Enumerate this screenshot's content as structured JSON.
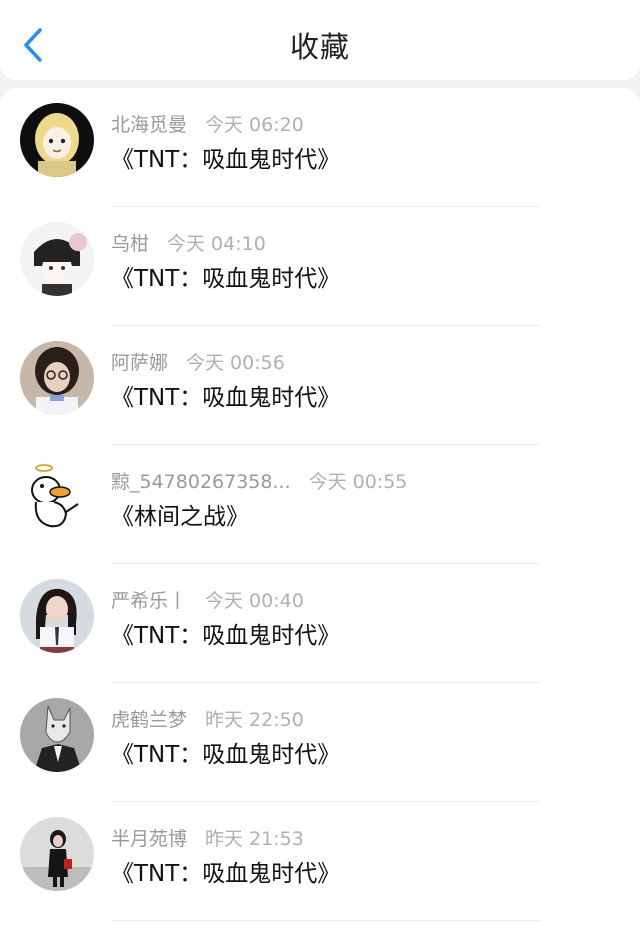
{
  "header": {
    "title": "收藏",
    "back_icon": "chevron-left-icon",
    "accent": "#1e90ff"
  },
  "items": [
    {
      "user": "北海觅曼",
      "time": "今天 06:20",
      "work": "《TNT：吸血鬼时代》",
      "avatar": "illustrated-girl-avatar"
    },
    {
      "user": "乌柑",
      "time": "今天 04:10",
      "work": "《TNT：吸血鬼时代》",
      "avatar": "anime-boy-avatar"
    },
    {
      "user": "阿萨娜",
      "time": "今天 00:56",
      "work": "《TNT：吸血鬼时代》",
      "avatar": "photo-girl-glasses-avatar"
    },
    {
      "user": "黥_54780267358...",
      "time": "今天 00:55",
      "work": "《林间之战》",
      "avatar": "cartoon-duck-avatar"
    },
    {
      "user": "严希乐丨",
      "time": "今天 00:40",
      "work": "《TNT：吸血鬼时代》",
      "avatar": "photo-girl-uniform-avatar"
    },
    {
      "user": "虎鹤兰梦",
      "time": "昨天 22:50",
      "work": "《TNT：吸血鬼时代》",
      "avatar": "wolf-suit-avatar"
    },
    {
      "user": "半月苑博",
      "time": "昨天 21:53",
      "work": "《TNT：吸血鬼时代》",
      "avatar": "photo-girl-dark-avatar"
    }
  ]
}
